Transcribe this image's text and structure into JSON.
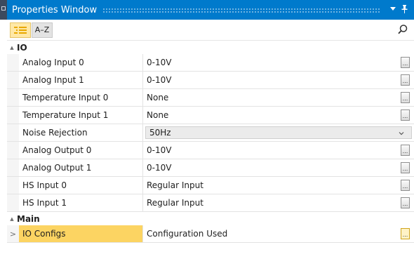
{
  "window": {
    "title": "Properties Window",
    "dropdown_glyph": "▾",
    "pin_glyph": "📌"
  },
  "toolbar": {
    "categorized_icon": "categorized-icon",
    "alphabetical_label": "A–Z",
    "search_icon": "search-icon"
  },
  "categories": [
    {
      "label": "IO",
      "expanded": true,
      "properties": [
        {
          "name": "Analog Input 0",
          "value": "0-10V",
          "editor": "ellipsis"
        },
        {
          "name": "Analog Input 1",
          "value": "0-10V",
          "editor": "ellipsis"
        },
        {
          "name": "Temperature Input 0",
          "value": "None",
          "editor": "ellipsis"
        },
        {
          "name": "Temperature Input 1",
          "value": "None",
          "editor": "ellipsis"
        },
        {
          "name": "Noise Rejection",
          "value": "50Hz",
          "editor": "dropdown"
        },
        {
          "name": "Analog Output 0",
          "value": "0-10V",
          "editor": "ellipsis"
        },
        {
          "name": "Analog Output 1",
          "value": "0-10V",
          "editor": "ellipsis"
        },
        {
          "name": "HS Input 0",
          "value": "Regular Input",
          "editor": "ellipsis"
        },
        {
          "name": "HS Input 1",
          "value": "Regular Input",
          "editor": "ellipsis"
        }
      ]
    },
    {
      "label": "Main",
      "expanded": true,
      "properties": [
        {
          "name": "IO Configs",
          "value": "Configuration Used",
          "editor": "ellipsis",
          "selected": true,
          "expandable": true
        }
      ]
    }
  ],
  "ellipsis_label": "...",
  "expand_glyph": ">",
  "collapse_glyph": "▲",
  "colors": {
    "titlebar": "#007acc",
    "selection": "#fcd462",
    "category_icon": "#e8a800"
  }
}
